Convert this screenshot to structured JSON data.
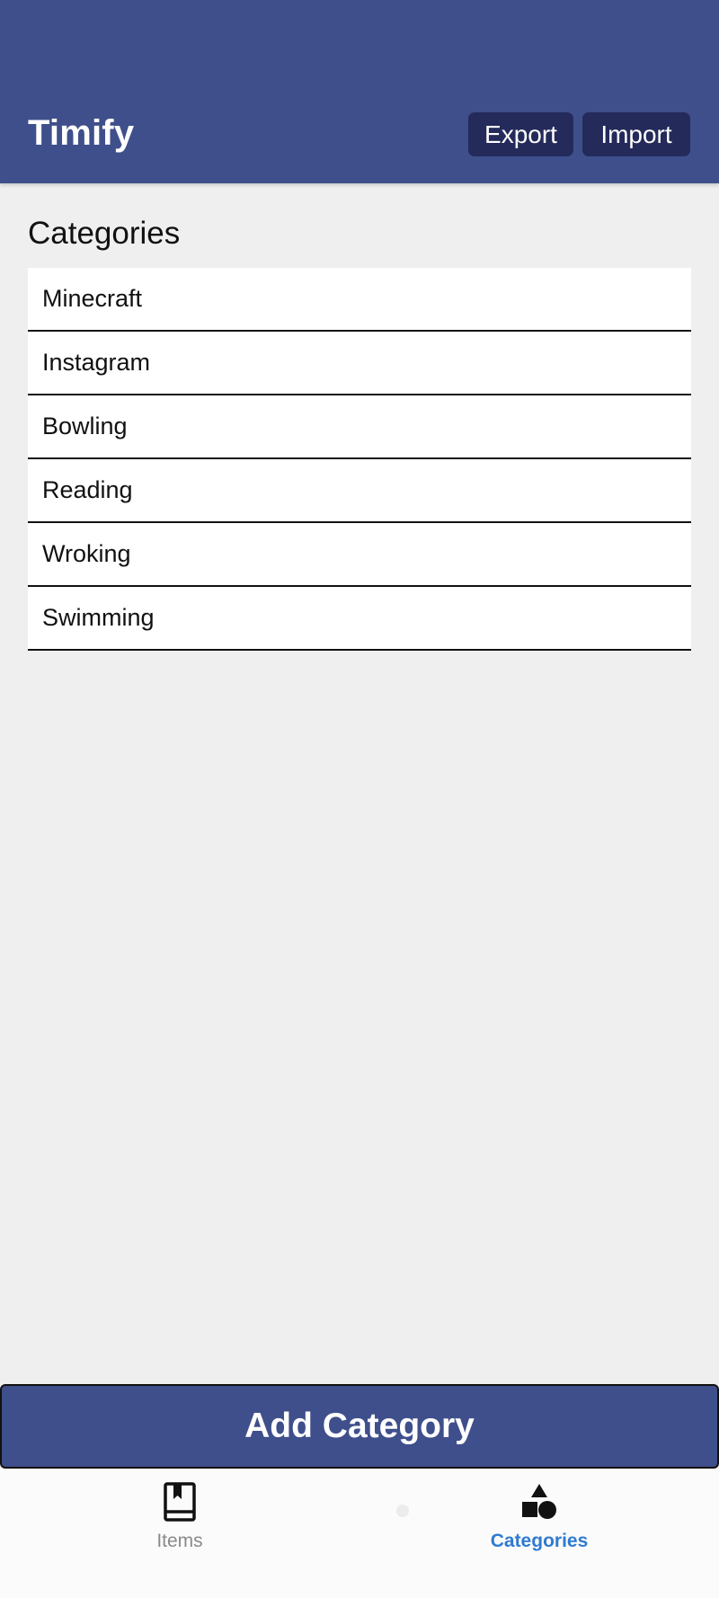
{
  "header": {
    "title": "Timify",
    "export_label": "Export",
    "import_label": "Import"
  },
  "section": {
    "title": "Categories"
  },
  "categories": [
    {
      "name": "Minecraft"
    },
    {
      "name": "Instagram"
    },
    {
      "name": "Bowling"
    },
    {
      "name": "Reading"
    },
    {
      "name": "Wroking"
    },
    {
      "name": "Swimming"
    }
  ],
  "add_button": {
    "label": "Add Category"
  },
  "bottom_nav": {
    "tabs": [
      {
        "label": "Items",
        "icon": "book-icon",
        "active": false
      },
      {
        "label": "Categories",
        "icon": "shapes-icon",
        "active": true
      }
    ]
  },
  "colors": {
    "primary": "#3f4f8b",
    "header_button": "#242a5a",
    "active_tab": "#2f7bd0",
    "inactive_tab": "#8a8a8a",
    "background": "#efefef"
  }
}
